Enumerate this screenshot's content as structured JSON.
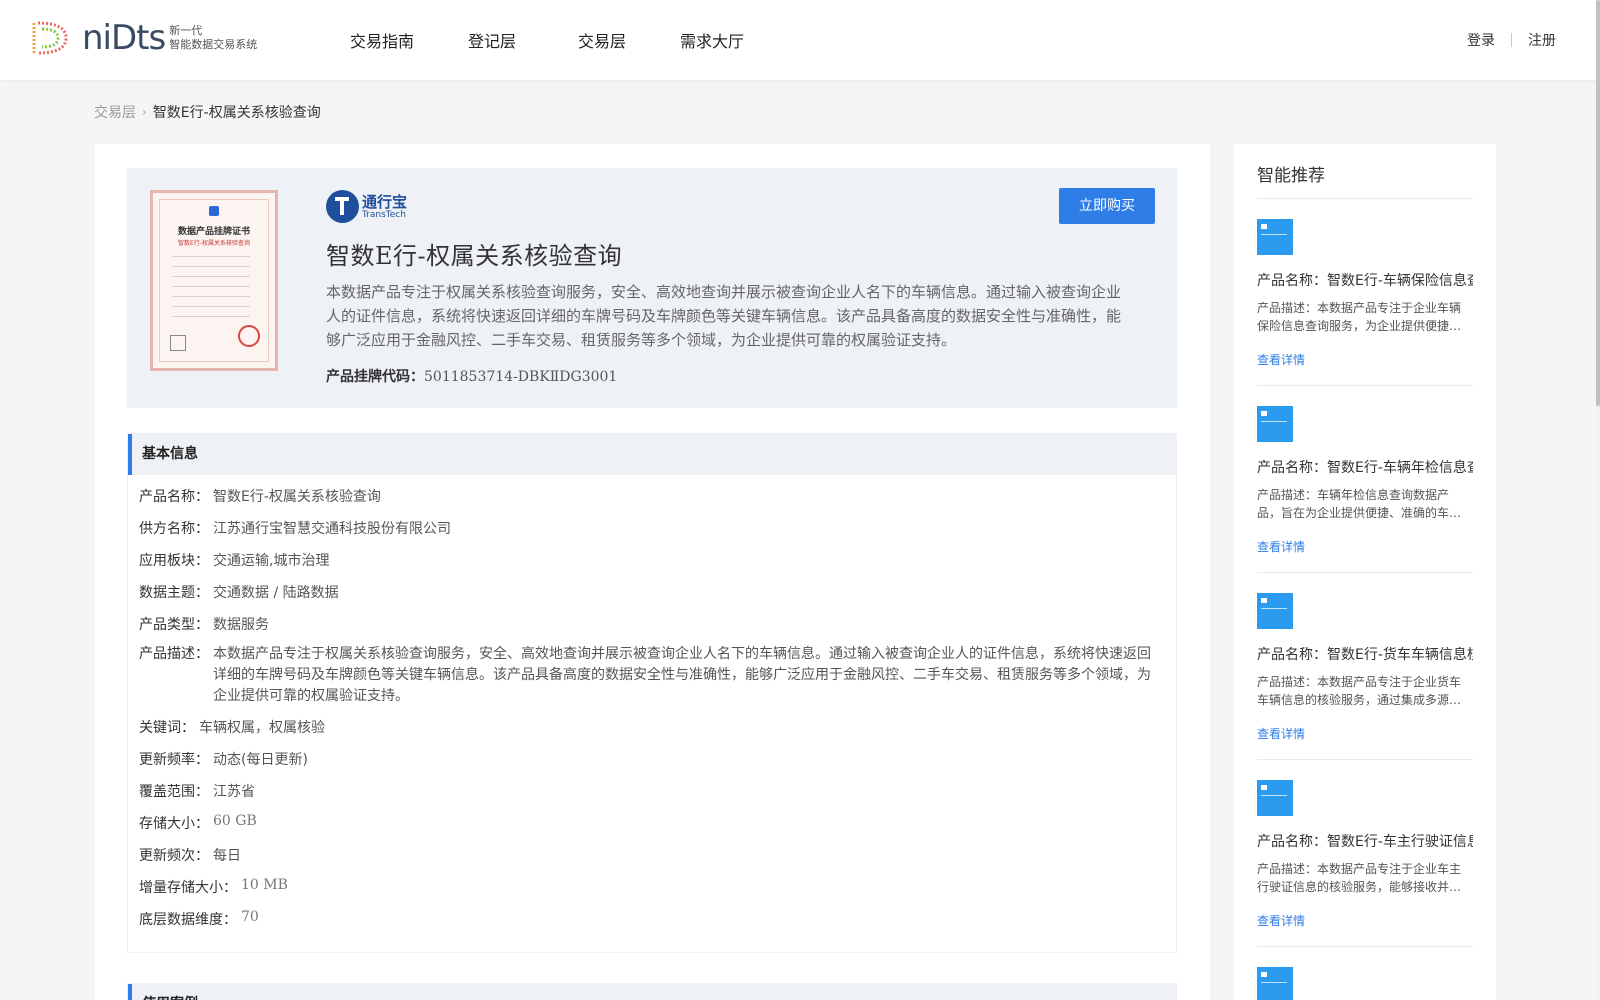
{
  "header": {
    "logo_text": "niDts",
    "logo_sub_1": "新一代",
    "logo_sub_2": "智能数据交易系统",
    "nav": [
      "交易指南",
      "登记层",
      "交易层",
      "需求大厅"
    ],
    "login": "登录",
    "register": "注册"
  },
  "breadcrumb": {
    "parent": "交易层",
    "current": "智数E行-权属关系核验查询"
  },
  "product": {
    "brand_cn": "通行宝",
    "brand_en": "TransTech",
    "cert_title": "数据产品挂牌证书",
    "cert_sub": "智数E行-权属关系核验查询",
    "title": "智数E行-权属关系核验查询",
    "description": "本数据产品专注于权属关系核验查询服务，安全、高效地查询并展示被查询企业人名下的车辆信息。通过输入被查询企业人的证件信息，系统将快速返回详细的车牌号码及车牌颜色等关键车辆信息。该产品具备高度的数据安全性与准确性，能够广泛应用于金融风控、二手车交易、租赁服务等多个领域，为企业提供可靠的权属验证支持。",
    "code_label": "产品挂牌代码：",
    "code_value": "5011853714-DBKⅡDG3001",
    "buy_label": "立即购买"
  },
  "basic_info": {
    "heading": "基本信息",
    "rows": [
      {
        "k": "产品名称：",
        "v": "智数E行-权属关系核验查询"
      },
      {
        "k": "供方名称：",
        "v": "江苏通行宝智慧交通科技股份有限公司"
      },
      {
        "k": "应用板块：",
        "v": "交通运输,城市治理"
      },
      {
        "k": "数据主题：",
        "v": "交通数据 / 陆路数据"
      },
      {
        "k": "产品类型：",
        "v": "数据服务"
      },
      {
        "k": "产品描述：",
        "v": "本数据产品专注于权属关系核验查询服务，安全、高效地查询并展示被查询企业人名下的车辆信息。通过输入被查询企业人的证件信息，系统将快速返回详细的车牌号码及车牌颜色等关键车辆信息。该产品具备高度的数据安全性与准确性，能够广泛应用于金融风控、二手车交易、租赁服务等多个领域，为企业提供可靠的权属验证支持。"
      },
      {
        "k": "关键词：",
        "v": "车辆权属，权属核验"
      },
      {
        "k": "更新频率：",
        "v": "动态(每日更新)"
      },
      {
        "k": "覆盖范围：",
        "v": "江苏省"
      },
      {
        "k": "存储大小：",
        "v": "60 GB"
      },
      {
        "k": "更新频次：",
        "v": "每日"
      },
      {
        "k": "增量存储大小：",
        "v": "10 MB"
      },
      {
        "k": "底层数据维度：",
        "v": "70"
      }
    ]
  },
  "use_case": {
    "heading": "使用案例"
  },
  "recommend": {
    "title": "智能推荐",
    "link_label": "查看详情",
    "items": [
      {
        "name": "产品名称：智数E行-车辆保险信息查询",
        "desc": "产品描述：本数据产品专注于企业车辆保险信息查询服务，为企业提供便捷…"
      },
      {
        "name": "产品名称：智数E行-车辆年检信息查询",
        "desc": "产品描述：车辆年检信息查询数据产品，旨在为企业提供便捷、准确的车…"
      },
      {
        "name": "产品名称：智数E行-货车车辆信息核验",
        "desc": "产品描述：本数据产品专注于企业货车车辆信息的核验服务，通过集成多源…"
      },
      {
        "name": "产品名称：智数E行-车主行驶证信息核验",
        "desc": "产品描述：本数据产品专注于企业车主行驶证信息的核验服务，能够接收并…"
      }
    ]
  }
}
